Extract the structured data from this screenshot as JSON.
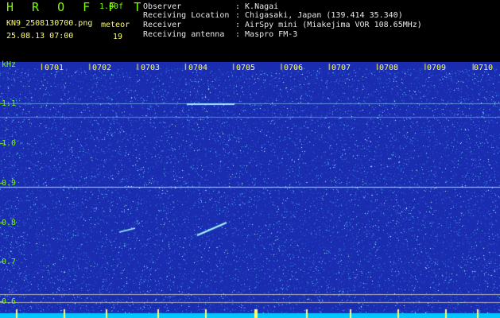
{
  "header": {
    "app_title": "H R O F F T",
    "version": "1.00f",
    "filename": "KN9_2508130700.png",
    "meteor_label": "meteor",
    "datetime": "25.08.13 07:00",
    "meteor_count": "19"
  },
  "info": [
    {
      "label": "Observer",
      "value": ": K.Nagai"
    },
    {
      "label": "Receiving Location",
      "value": ": Chigasaki, Japan (139.414 35.340)"
    },
    {
      "label": "Receiver",
      "value": ": AirSpy mini (Miakejima VOR 108.65MHz)"
    },
    {
      "label": "Receiving antenna",
      "value": ": Maspro FM-3"
    }
  ],
  "spectrogram": {
    "y_unit": "kHz",
    "y_ticks": [
      "1.1",
      "1.0",
      "0.9",
      "0.8",
      "0.7",
      "0.6"
    ],
    "x_ticks": [
      "0701",
      "0702",
      "0703",
      "0704",
      "0705",
      "0706",
      "0707",
      "0708",
      "0709",
      "0710"
    ],
    "colors": {
      "background": "#1a2cb0",
      "noise": "#8ff4ff",
      "tick": "#ffff66",
      "axis": "#7CFC00"
    }
  }
}
